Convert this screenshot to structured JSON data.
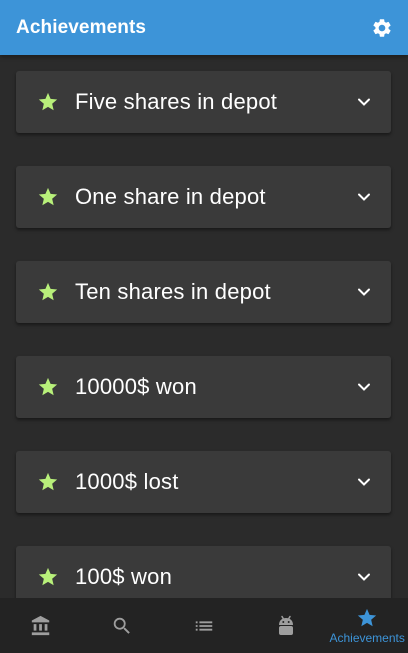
{
  "header": {
    "title": "Achievements",
    "settings_icon": "gear-icon"
  },
  "achievements": [
    {
      "label": "Five shares in depot",
      "icon": "star-icon"
    },
    {
      "label": "One share in depot",
      "icon": "star-icon"
    },
    {
      "label": "Ten shares in depot",
      "icon": "star-icon"
    },
    {
      "label": "10000$ won",
      "icon": "star-icon"
    },
    {
      "label": "1000$ lost",
      "icon": "star-icon"
    },
    {
      "label": "100$ won",
      "icon": "star-icon"
    }
  ],
  "bottom_nav": {
    "items": [
      {
        "icon": "bank-icon",
        "label": ""
      },
      {
        "icon": "search-icon",
        "label": ""
      },
      {
        "icon": "list-icon",
        "label": ""
      },
      {
        "icon": "android-icon",
        "label": ""
      },
      {
        "icon": "star-icon",
        "label": "Achievements",
        "active": true
      }
    ]
  },
  "colors": {
    "primary": "#3d94d8",
    "background": "#2b2b2b",
    "card": "#3a3a3a",
    "star": "#b8f07a",
    "nav_background": "#232323",
    "nav_icon_inactive": "#9e9e9e"
  }
}
